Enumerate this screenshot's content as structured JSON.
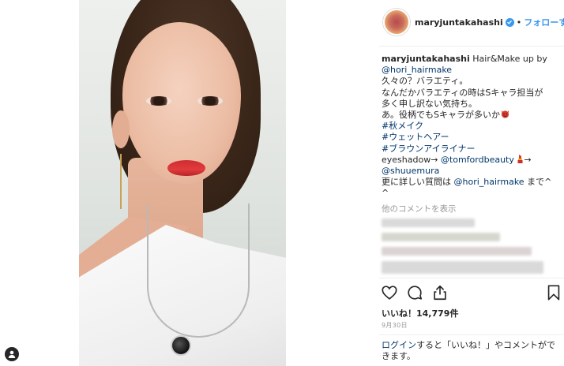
{
  "header": {
    "username": "maryjuntakahashi",
    "separator": "•",
    "follow_label": "フォローする"
  },
  "caption": {
    "username": "maryjuntakahashi",
    "line1_text": "Hair&Make up by",
    "line2_link": "@hori_hairmake",
    "line3": "久々の？バラエティ。",
    "line4": "なんだかバラエティの時はSキャラ担当が",
    "line5": "多く申し訳ない気持ち。",
    "line6": "あ。役柄でもSキャラが多いか",
    "hashtag1": "#秋メイク",
    "hashtag2": "#ウェットヘアー",
    "hashtag3": "#ブラウンアイライナー",
    "line10_text": "eyeshadow→",
    "line10_link": "@tomfordbeauty",
    "line10_arrow": "→",
    "line11_link": "@shuuemura",
    "line12_text": "更に詳しい質問は",
    "line12_link": "@hori_hairmake",
    "line12_tail": "まで^",
    "line13": "^"
  },
  "comments": {
    "view_more_label": "他のコメントを表示"
  },
  "actions": {
    "like_icon": "heart-icon",
    "comment_icon": "comment-icon",
    "share_icon": "share-icon",
    "save_icon": "bookmark-icon"
  },
  "likes_text": "いいね！14,779件",
  "date_text": "9月30日",
  "login": {
    "link": "ログイン",
    "text": "すると「いいね！」やコメントができます。"
  },
  "colors": {
    "link_blue": "#3897f0",
    "link_dark": "#003569",
    "text": "#262626",
    "muted": "#999999"
  }
}
